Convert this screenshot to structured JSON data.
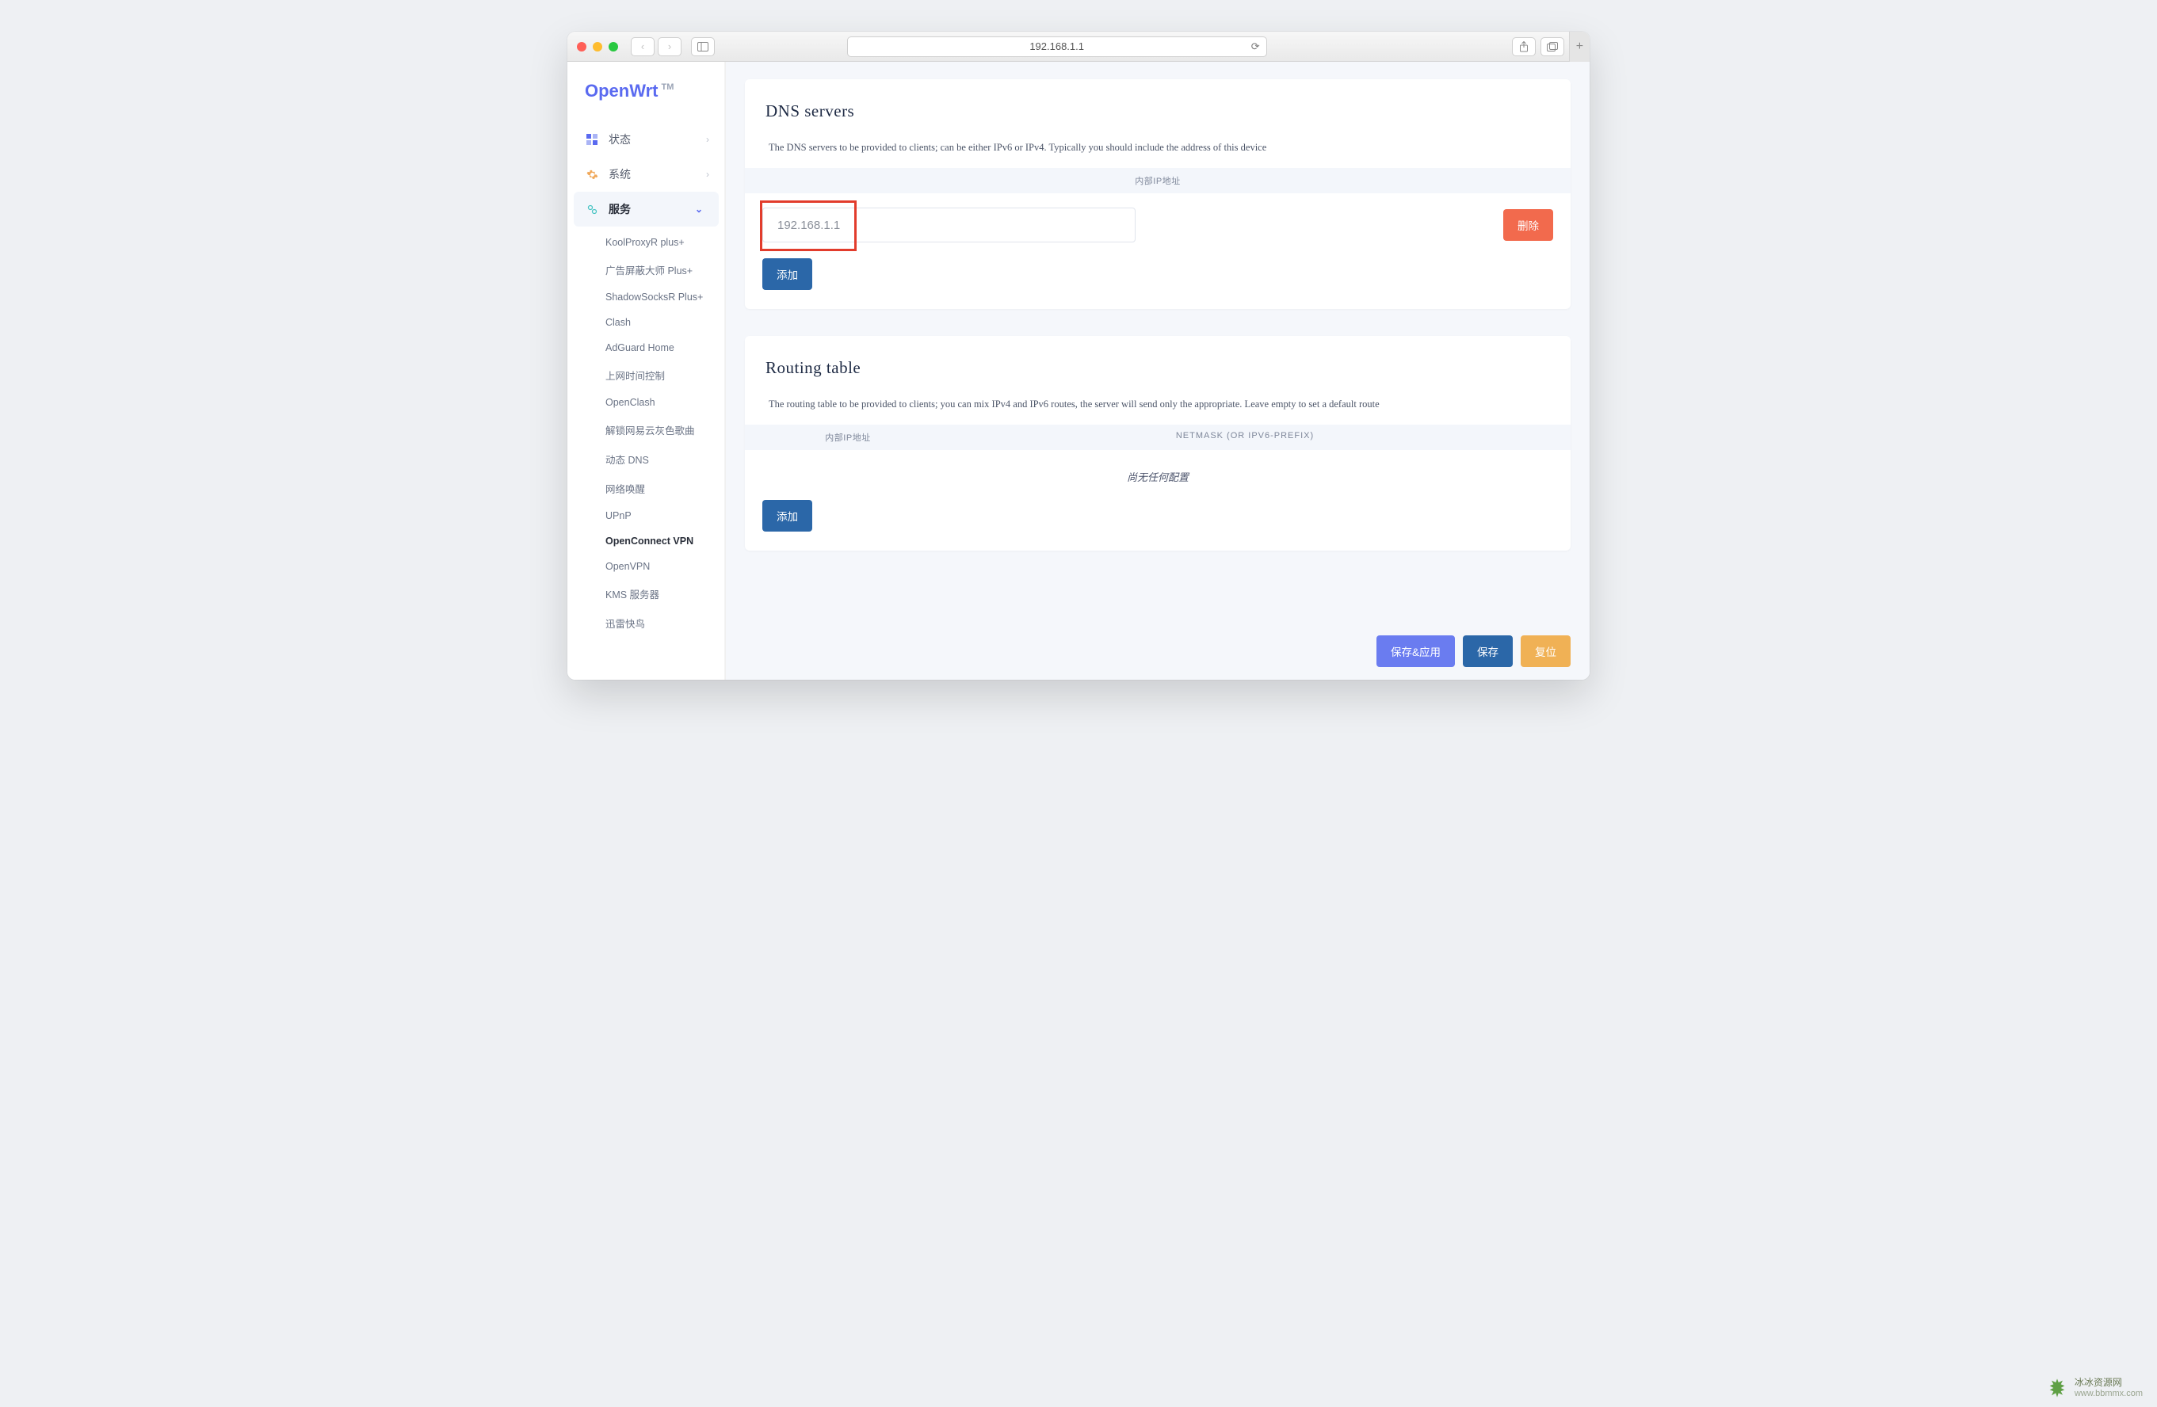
{
  "browser": {
    "url": "192.168.1.1"
  },
  "logo": {
    "text": "OpenWrt",
    "tm": "TM"
  },
  "nav": {
    "status": "状态",
    "system": "系统",
    "services": "服务"
  },
  "subnav": [
    "KoolProxyR plus+",
    "广告屏蔽大师 Plus+",
    "ShadowSocksR Plus+",
    "Clash",
    "AdGuard Home",
    "上网时间控制",
    "OpenClash",
    "解锁网易云灰色歌曲",
    "动态 DNS",
    "网络唤醒",
    "UPnP",
    "OpenConnect VPN",
    "OpenVPN",
    "KMS 服务器",
    "迅雷快鸟"
  ],
  "subnav_current_index": 11,
  "dns_panel": {
    "title": "DNS servers",
    "desc": "The DNS servers to be provided to clients; can be either IPv6 or IPv4. Typically you should include the address of this device",
    "col_ip": "内部IP地址",
    "value": "192.168.1.1",
    "delete": "删除",
    "add": "添加"
  },
  "routing_panel": {
    "title": "Routing table",
    "desc": "The routing table to be provided to clients; you can mix IPv4 and IPv6 routes, the server will send only the appropriate. Leave empty to set a default route",
    "col_ip": "内部IP地址",
    "col_netmask": "NETMASK (OR IPV6-PREFIX)",
    "empty": "尚无任何配置",
    "add": "添加"
  },
  "footer": {
    "save_apply": "保存&应用",
    "save": "保存",
    "reset": "复位"
  },
  "watermark": {
    "name": "冰冰资源网",
    "url": "www.bbmmx.com"
  }
}
